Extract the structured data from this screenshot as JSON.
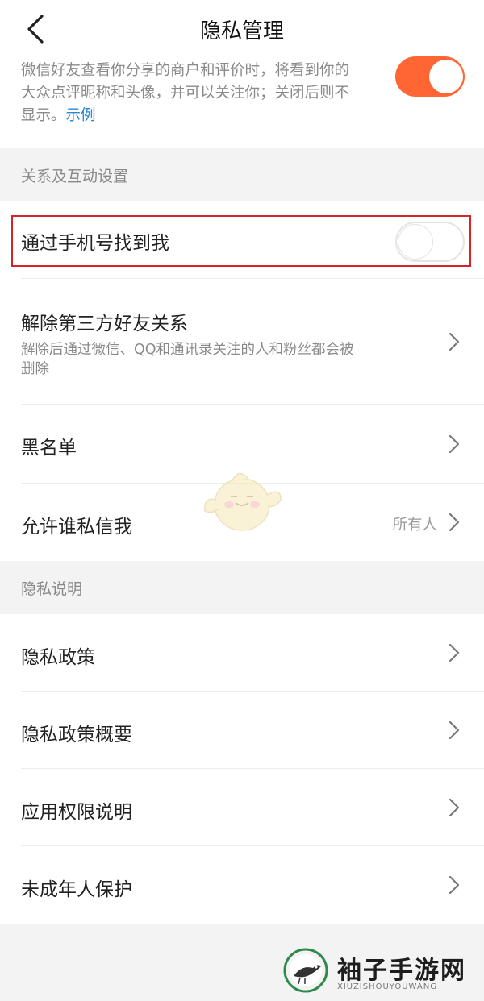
{
  "header": {
    "title": "隐私管理",
    "back_icon": "chevron-left-icon"
  },
  "top_setting": {
    "description": "微信好友查看你分享的商户和评价时，将看到你的大众点评昵称和头像，并可以关注你；关闭后则不显示。",
    "link": "示例",
    "toggle_on": true,
    "toggle_color": "#ff6633"
  },
  "section_relations": {
    "title": "关系及互动设置",
    "items": [
      {
        "label": "通过手机号找到我",
        "toggle_on": false
      },
      {
        "label": "解除第三方好友关系",
        "sub": "解除后通过微信、QQ和通讯录关注的人和粉丝都会被删除"
      },
      {
        "label": "黑名单"
      },
      {
        "label": "允许谁私信我",
        "value": "所有人"
      }
    ]
  },
  "section_privacy": {
    "title": "隐私说明",
    "items": [
      {
        "label": "隐私政策"
      },
      {
        "label": "隐私政策概要"
      },
      {
        "label": "应用权限说明"
      },
      {
        "label": "未成年人保护"
      }
    ]
  },
  "watermark": {
    "text": "袖子手游网",
    "sub": "XIUZISHOUYOUWANG"
  },
  "colors": {
    "accent": "#ff6633",
    "link": "#2a86d8",
    "highlight_border": "#d9212a"
  }
}
